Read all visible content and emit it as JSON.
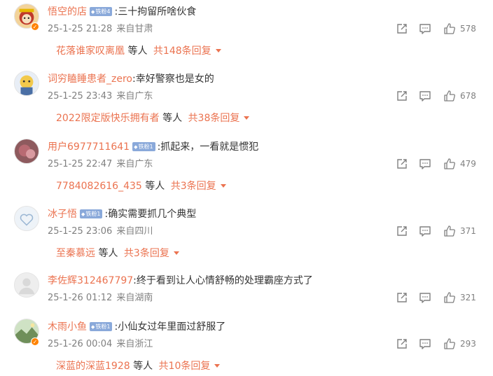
{
  "comments": [
    {
      "username": "悟空的店",
      "fan_badge": "铁粉4",
      "has_fan_badge": true,
      "text": ":三十拘留所啥伙食",
      "time": "25-1-25 21:28",
      "location": "来自甘肃",
      "likes": "578",
      "reply_user": "花落谁家叹离凰",
      "reply_etc": "等人",
      "reply_count": "共148条回复",
      "avatar_icon": "monkey-king-avatar",
      "avatar_color": "#c0392b"
    },
    {
      "username": "词穷瞌睡患者_zero",
      "fan_badge": "",
      "has_fan_badge": false,
      "text": ":幸好警察也是女的",
      "time": "25-1-25 23:43",
      "location": "来自广东",
      "likes": "678",
      "reply_user": "2022限定版快乐拥有者",
      "reply_etc": "等人",
      "reply_count": "共38条回复",
      "avatar_icon": "cartoon-avatar",
      "avatar_color": "#4a6fa5"
    },
    {
      "username": "用户6977711641",
      "fan_badge": "铁粉1",
      "has_fan_badge": true,
      "text": ":抓起来，一看就是惯犯",
      "time": "25-1-25 22:47",
      "location": "来自广东",
      "likes": "479",
      "reply_user": "7784082616_435",
      "reply_etc": "等人",
      "reply_count": "共3条回复",
      "avatar_icon": "photo-avatar",
      "avatar_color": "#b86a72"
    },
    {
      "username": "冰子悟",
      "fan_badge": "铁粉1",
      "has_fan_badge": true,
      "text": ":确实需要抓几个典型",
      "time": "25-1-25 23:06",
      "location": "来自四川",
      "likes": "371",
      "reply_user": "至秦慕远",
      "reply_etc": "等人",
      "reply_count": "共3条回复",
      "avatar_icon": "heart-avatar",
      "avatar_color": "#9bb7d4"
    },
    {
      "username": "李佐辉312467797",
      "fan_badge": "",
      "has_fan_badge": false,
      "text": ":终于看到让人心情舒畅的处理霸座方式了",
      "time": "25-1-26 01:12",
      "location": "来自湖南",
      "likes": "321",
      "reply_user": "",
      "reply_etc": "",
      "reply_count": "",
      "avatar_icon": "default-user-avatar",
      "avatar_color": "#d9d9d9"
    },
    {
      "username": "木雨小鱼",
      "fan_badge": "铁粉1",
      "has_fan_badge": true,
      "text": ":小仙女过年里面过舒服了",
      "time": "25-1-26 00:04",
      "location": "来自浙江",
      "likes": "293",
      "reply_user": "深蓝的深蓝1928",
      "reply_etc": "等人",
      "reply_count": "共10条回复",
      "avatar_icon": "landscape-avatar",
      "avatar_color": "#6f8f5a"
    }
  ],
  "colors": {
    "username": "#eb7350",
    "meta": "#808080",
    "fan_badge": "#8aa9da",
    "icon": "#808080"
  }
}
